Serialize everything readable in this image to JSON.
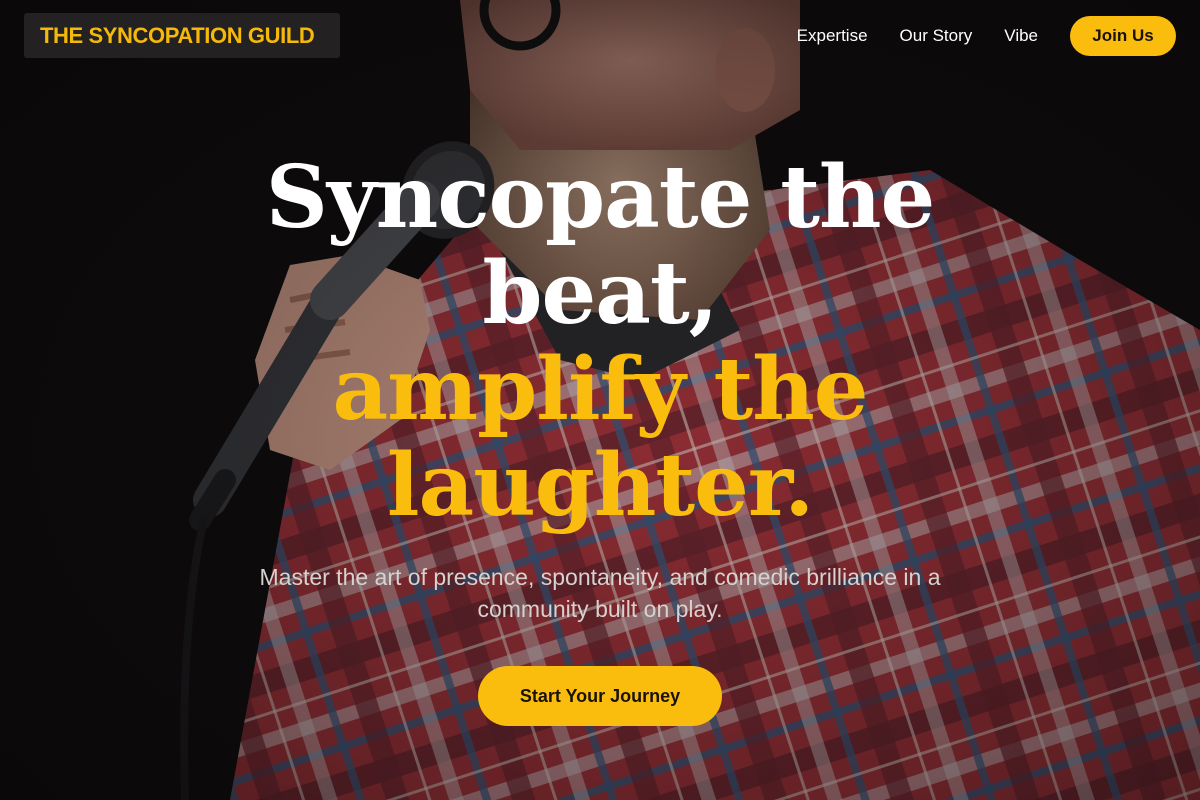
{
  "brand": {
    "name": "THE SYNCOPATION GUILD"
  },
  "nav": {
    "links": [
      "Expertise",
      "Our Story",
      "Vibe"
    ],
    "join_label": "Join Us"
  },
  "hero": {
    "headline_line1": "Syncopate the",
    "headline_line2": "beat,",
    "headline_line3": "amplify the",
    "headline_line4": "laughter.",
    "subtitle": "Master the art of presence, spontaneity, and comedic brilliance in a community built on play.",
    "cta_label": "Start Your Journey",
    "background_image": "comedian-with-microphone-photo"
  },
  "colors": {
    "accent": "#fbbd0d",
    "background": "#0d0b0b",
    "text": "#ffffff"
  }
}
